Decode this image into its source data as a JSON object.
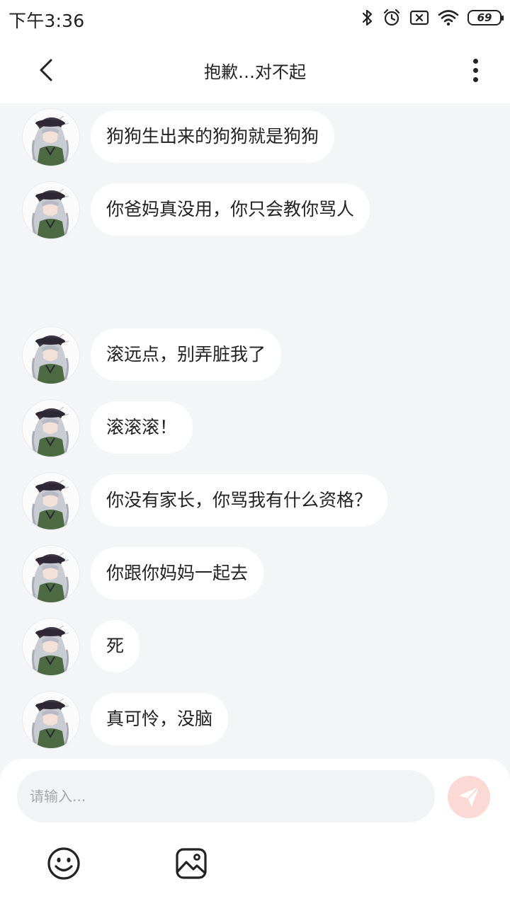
{
  "status_bar": {
    "time": "下午3:36",
    "battery_level": "69",
    "icons": [
      "bluetooth-icon",
      "alarm-icon",
      "no-sim-icon",
      "wifi-icon",
      "battery-icon"
    ]
  },
  "header": {
    "title": "抱歉…对不起",
    "back_icon": "chevron-left-icon",
    "more_icon": "more-vertical-icon"
  },
  "messages": [
    {
      "text": "狗狗生出来的狗狗就是狗狗"
    },
    {
      "text": "你爸妈真没用，你只会教你骂人"
    },
    {
      "text": "滚远点，别弄脏我了"
    },
    {
      "text": "滚滚滚！"
    },
    {
      "text": "你没有家长，你骂我有什么资格？"
    },
    {
      "text": "你跟你妈妈一起去"
    },
    {
      "text": "死"
    },
    {
      "text": "真可怜，没脑"
    }
  ],
  "input": {
    "placeholder": "请输入...",
    "value": ""
  },
  "toolbar": {
    "send_icon": "paper-plane-icon",
    "emoji_icon": "smiley-icon",
    "image_icon": "image-icon"
  },
  "colors": {
    "chat_background": "#f3f5f6",
    "bubble": "#ffffff",
    "send_button": "#fbd9d4",
    "send_icon": "#ffffff"
  }
}
